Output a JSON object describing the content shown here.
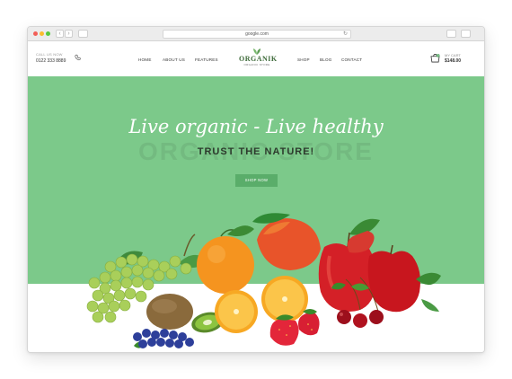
{
  "browser": {
    "url": "google.com",
    "back_glyph": "‹",
    "forward_glyph": "›",
    "reload_glyph": "↻"
  },
  "header": {
    "call_label": "CALL US NOW",
    "call_number": "0122 333 8889",
    "nav": [
      "HOME",
      "ABOUT US",
      "FEATURES",
      "SHOP",
      "BLOG",
      "CONTACT"
    ],
    "logo_name": "ORGANIK",
    "logo_sub": "ORGANIC STORE",
    "cart_label": "MY CART",
    "cart_amount": "$148.00",
    "cart_count": "0"
  },
  "hero": {
    "script_heading": "Live organic - Live healthy",
    "watermark": "ORGANIC STORE",
    "tagline": "TRUST THE NATURE!",
    "button_label": "SHOP NOW"
  },
  "colors": {
    "hero_bg": "#7cc98a",
    "button_bg": "#5aad6a",
    "logo_green": "#3e6b3a"
  },
  "icons": [
    "phone-icon",
    "cart-icon",
    "leaf-logo-icon",
    "share-icon",
    "tabs-icon",
    "sidebar-icon"
  ]
}
